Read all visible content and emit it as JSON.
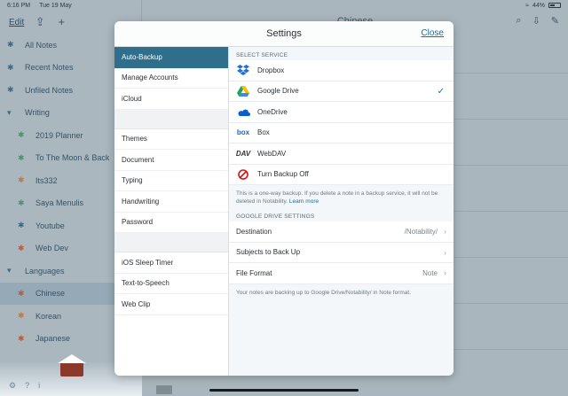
{
  "status_bar": {
    "time": "6:16 PM",
    "date": "Tue 19 May",
    "battery": "44%"
  },
  "sidebar": {
    "edit_label": "Edit",
    "items": [
      {
        "label": "All Notes",
        "icon": "asterisk-icon",
        "sub": false
      },
      {
        "label": "Recent Notes",
        "icon": "asterisk-icon",
        "sub": false
      },
      {
        "label": "Unfiled Notes",
        "icon": "asterisk-icon",
        "sub": false
      },
      {
        "label": "Writing",
        "icon": "chevron-down-icon",
        "sub": false
      },
      {
        "label": "2019 Planner",
        "icon": "asterisk-icon",
        "sub": true,
        "color": "#4f8f74"
      },
      {
        "label": "To The Moon & Back",
        "icon": "asterisk-icon",
        "sub": true,
        "color": "#4f8f74"
      },
      {
        "label": "Its332",
        "icon": "asterisk-icon",
        "sub": true,
        "color": "#c07a3a"
      },
      {
        "label": "Saya Menulis",
        "icon": "asterisk-icon",
        "sub": true,
        "color": "#4f8f74"
      },
      {
        "label": "Youtube",
        "icon": "asterisk-icon",
        "sub": true,
        "color": "#3c6a86"
      },
      {
        "label": "Web Dev",
        "icon": "asterisk-icon",
        "sub": true,
        "color": "#c05a3a"
      },
      {
        "label": "Languages",
        "icon": "chevron-down-icon",
        "sub": false
      },
      {
        "label": "Chinese",
        "icon": "asterisk-icon",
        "sub": true,
        "color": "#c05a3a",
        "selected": true
      },
      {
        "label": "Korean",
        "icon": "asterisk-icon",
        "sub": true,
        "color": "#c07a3a"
      },
      {
        "label": "Japanese",
        "icon": "asterisk-icon",
        "sub": true,
        "color": "#c05a3a"
      }
    ]
  },
  "main": {
    "title": "Chinese"
  },
  "modal": {
    "title": "Settings",
    "close_label": "Close",
    "nav_groups": [
      [
        "Auto-Backup",
        "Manage Accounts",
        "iCloud"
      ],
      [
        "Themes",
        "Document",
        "Typing",
        "Handwriting",
        "Password"
      ],
      [
        "iOS Sleep Timer",
        "Text-to-Speech",
        "Web Clip"
      ]
    ],
    "active_nav": "Auto-Backup",
    "select_service_header": "SELECT SERVICE",
    "services": [
      {
        "label": "Dropbox",
        "icon": "dropbox-icon",
        "selected": false
      },
      {
        "label": "Google Drive",
        "icon": "google-drive-icon",
        "selected": true
      },
      {
        "label": "OneDrive",
        "icon": "onedrive-icon",
        "selected": false
      },
      {
        "label": "Box",
        "icon": "box-icon",
        "selected": false
      },
      {
        "label": "WebDAV",
        "icon": "webdav-icon",
        "selected": false
      },
      {
        "label": "Turn Backup Off",
        "icon": "backup-off-icon",
        "selected": false
      }
    ],
    "note_text": "This is a one-way backup. If you delete a note in a backup service, it will not be deleted in Notability.",
    "note_link": "Learn more",
    "gdrive_header": "GOOGLE DRIVE SETTINGS",
    "gdrive_rows": [
      {
        "label": "Destination",
        "value": "/Notability/"
      },
      {
        "label": "Subjects to Back Up",
        "value": ""
      },
      {
        "label": "File Format",
        "value": "Note"
      }
    ],
    "footer_note": "Your notes are backing up to Google Drive/Notability/ in Note format.",
    "colors": {
      "accent": "#2f6f8c",
      "link": "#1e6a9a"
    }
  }
}
